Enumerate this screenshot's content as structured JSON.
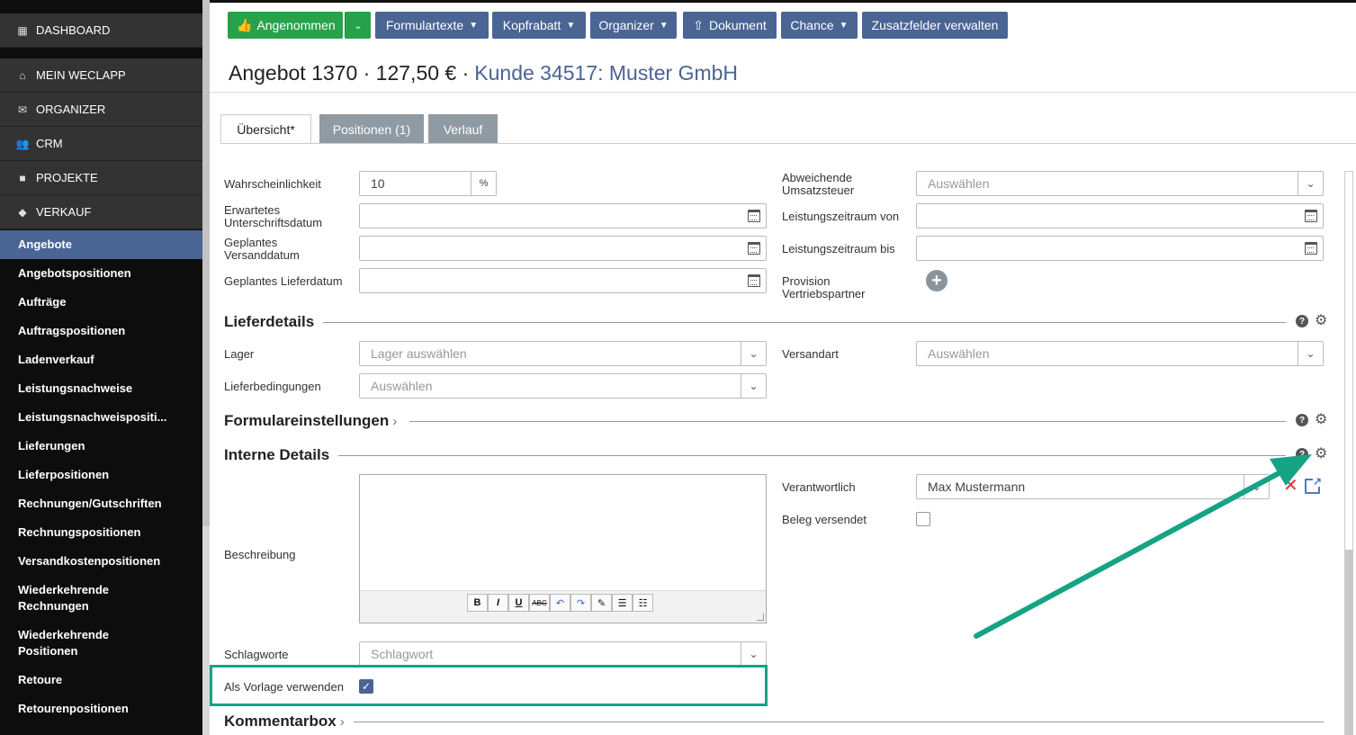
{
  "sidebar": {
    "top_items": [
      {
        "label": "DASHBOARD",
        "icon": "grid-icon"
      },
      {
        "label": "MEIN WECLAPP",
        "icon": "home-icon"
      },
      {
        "label": "ORGANIZER",
        "icon": "mail-icon"
      },
      {
        "label": "CRM",
        "icon": "users-icon"
      },
      {
        "label": "PROJEKTE",
        "icon": "briefcase-icon"
      },
      {
        "label": "VERKAUF",
        "icon": "tag-icon"
      }
    ],
    "sub_items": [
      {
        "label": "Angebote",
        "active": true
      },
      {
        "label": "Angebotspositionen"
      },
      {
        "label": "Aufträge"
      },
      {
        "label": "Auftragspositionen"
      },
      {
        "label": "Ladenverkauf"
      },
      {
        "label": "Leistungsnachweise"
      },
      {
        "label": "Leistungsnachweispositi..."
      },
      {
        "label": "Lieferungen"
      },
      {
        "label": "Lieferpositionen"
      },
      {
        "label": "Rechnungen/Gutschriften"
      },
      {
        "label": "Rechnungspositionen"
      },
      {
        "label": "Versandkostenpositionen"
      },
      {
        "label": "Wiederkehrende Rechnungen"
      },
      {
        "label": "Wiederkehrende Positionen"
      },
      {
        "label": "Retoure"
      },
      {
        "label": "Retourenpositionen"
      }
    ]
  },
  "toolbar": {
    "status_label": "Angenommen",
    "formulartexte": "Formulartexte",
    "kopfrabatt": "Kopfrabatt",
    "organizer": "Organizer",
    "dokument": "Dokument",
    "chance": "Chance",
    "zusatzfelder": "Zusatzfelder verwalten"
  },
  "header": {
    "title": "Angebot 1370 · 127,50 € ·",
    "customer_link": "Kunde 34517: Muster GmbH"
  },
  "tabs": [
    {
      "label": "Übersicht*",
      "active": true
    },
    {
      "label": "Positionen (1)"
    },
    {
      "label": "Verlauf"
    }
  ],
  "form": {
    "wahrscheinlichkeit": {
      "label": "Wahrscheinlichkeit",
      "value": "10",
      "unit": "%"
    },
    "unterschriftsdatum": {
      "label": "Erwartetes Unterschriftsdatum"
    },
    "versanddatum": {
      "label": "Geplantes Versanddatum"
    },
    "lieferdatum": {
      "label": "Geplantes Lieferdatum"
    },
    "umsatzsteuer": {
      "label": "Abweichende Umsatzsteuer",
      "placeholder": "Auswählen"
    },
    "leistung_von": {
      "label": "Leistungszeitraum von"
    },
    "leistung_bis": {
      "label": "Leistungszeitraum bis"
    },
    "provision": {
      "label": "Provision Vertriebspartner"
    }
  },
  "lieferdetails": {
    "title": "Lieferdetails",
    "lager": {
      "label": "Lager",
      "placeholder": "Lager auswählen"
    },
    "versandart": {
      "label": "Versandart",
      "placeholder": "Auswählen"
    },
    "lieferbedingungen": {
      "label": "Lieferbedingungen",
      "placeholder": "Auswählen"
    }
  },
  "formulareinstellungen": {
    "title": "Formulareinstellungen"
  },
  "interne_details": {
    "title": "Interne Details",
    "beschreibung": {
      "label": "Beschreibung"
    },
    "verantwortlich": {
      "label": "Verantwortlich",
      "value": "Max Mustermann"
    },
    "beleg_versendet": {
      "label": "Beleg versendet",
      "checked": false
    },
    "schlagworte": {
      "label": "Schlagworte",
      "placeholder": "Schlagwort"
    },
    "vorlage": {
      "label": "Als Vorlage verwenden",
      "checked": true
    }
  },
  "kommentarbox": {
    "title": "Kommentarbox"
  },
  "colors": {
    "accent": "#4a6494",
    "success": "#27a24a",
    "highlight": "#16a383",
    "sidebar": "#0d0d0d"
  }
}
